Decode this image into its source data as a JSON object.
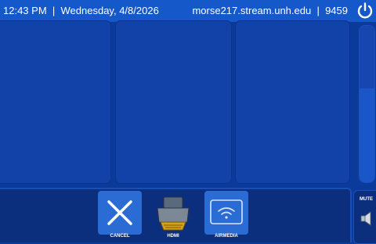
{
  "header": {
    "time": "12:43 PM",
    "separator": "|",
    "date": "Wednesday, 4/8/2026",
    "host": "morse217.stream.unh.edu",
    "code": "9459"
  },
  "volume": {
    "level_percent": 60
  },
  "sources": [
    {
      "label": "CANCEL",
      "icon": "x-icon",
      "active": true
    },
    {
      "label": "HDMI",
      "icon": "hdmi-icon",
      "active": false
    },
    {
      "label": "AIRMEDIA",
      "icon": "wifi-screen-icon",
      "active": true
    }
  ],
  "mute": {
    "label": "MUTE",
    "icon": "speaker-icon"
  },
  "colors": {
    "accent": "#1558c9",
    "background": "#0a3a9a",
    "hdmi_gold": "#d6a21a"
  }
}
